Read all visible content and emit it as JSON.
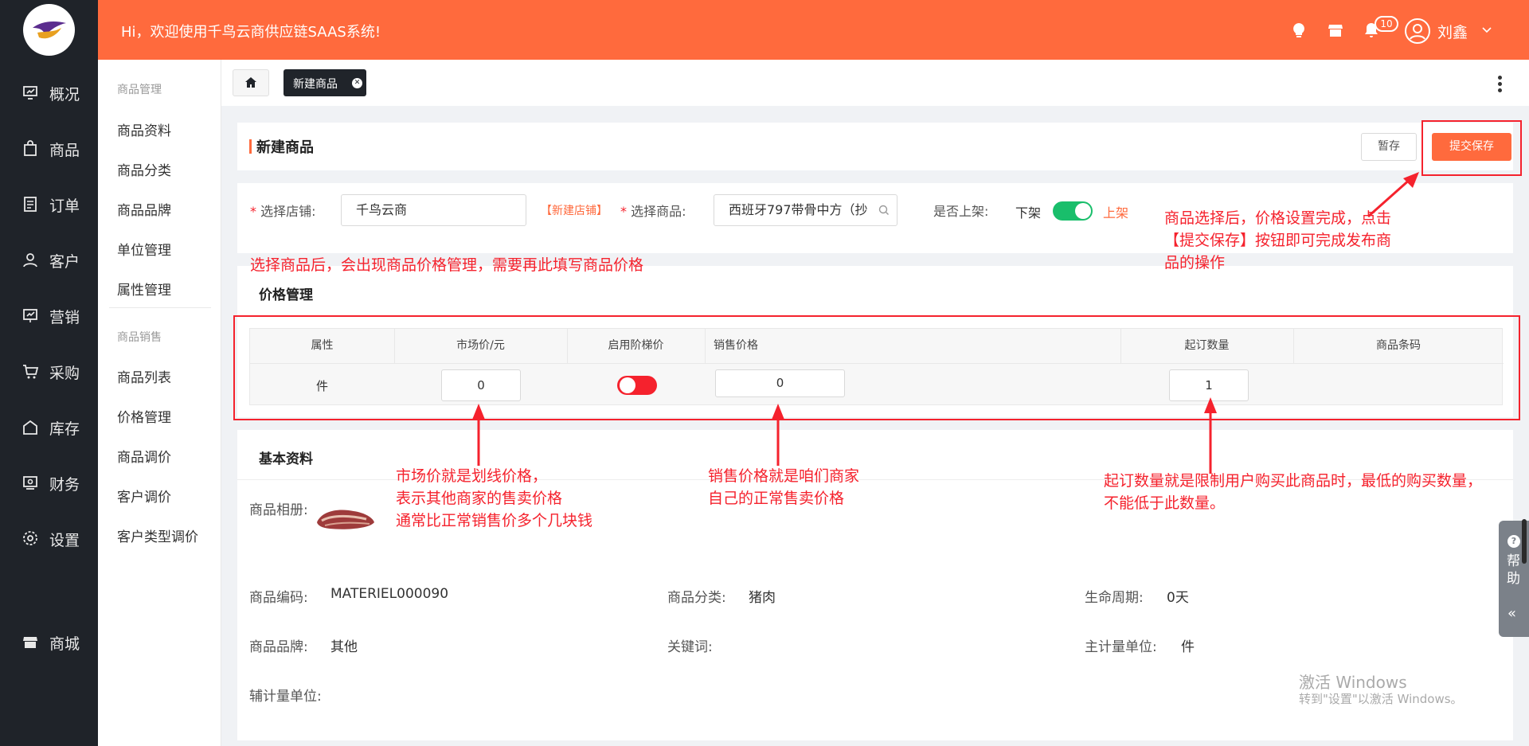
{
  "topbar": {
    "welcome": "Hi，欢迎使用千鸟云商供应链SAAS系统!",
    "notification_count": "10",
    "username": "刘鑫",
    "brand_color": "#ff6a3d"
  },
  "nav": {
    "items": [
      {
        "label": "概况",
        "icon": "dashboard-icon"
      },
      {
        "label": "商品",
        "icon": "shopping-bag-icon"
      },
      {
        "label": "订单",
        "icon": "order-icon"
      },
      {
        "label": "客户",
        "icon": "user-icon"
      },
      {
        "label": "营销",
        "icon": "marketing-icon"
      },
      {
        "label": "采购",
        "icon": "cart-icon"
      },
      {
        "label": "库存",
        "icon": "warehouse-icon"
      },
      {
        "label": "财务",
        "icon": "finance-icon"
      },
      {
        "label": "设置",
        "icon": "gear-icon"
      },
      {
        "label": "商城",
        "icon": "store-icon"
      }
    ]
  },
  "submenu": {
    "group1_title": "商品管理",
    "group1_items": [
      "商品资料",
      "商品分类",
      "商品品牌",
      "单位管理",
      "属性管理"
    ],
    "group2_title": "商品销售",
    "group2_items": [
      "商品列表",
      "价格管理",
      "商品调价",
      "客户调价",
      "客户类型调价"
    ]
  },
  "tabs": {
    "active_tab": "新建商品"
  },
  "form": {
    "page_title": "新建商品",
    "draft_button": "暂存",
    "submit_button": "提交保存",
    "store_label": "选择店铺:",
    "store_value": "千鸟云商",
    "new_store_link": "【新建店铺】",
    "product_label": "选择商品:",
    "product_value": "西班牙797带骨中方（抄",
    "shelf_label": "是否上架:",
    "shelf_off": "下架",
    "shelf_on": "上架",
    "shelf_enabled": true
  },
  "price": {
    "section_title": "价格管理",
    "columns": [
      "属性",
      "市场价/元",
      "启用阶梯价",
      "销售价格",
      "起订数量",
      "商品条码"
    ],
    "row": {
      "attribute": "件",
      "market_price": "0",
      "tiered_enabled": false,
      "sale_price": "0",
      "min_qty": "1",
      "barcode": ""
    }
  },
  "basic": {
    "section_title": "基本资料",
    "album_label": "商品相册:",
    "code_label": "商品编码:",
    "code_value": "MATERIEL000090",
    "category_label": "商品分类:",
    "category_value": "猪肉",
    "lifecycle_label": "生命周期:",
    "lifecycle_value": "0天",
    "brand_label": "商品品牌:",
    "brand_value": "其他",
    "keyword_label": "关键词:",
    "main_unit_label": "主计量单位:",
    "main_unit_value": "件",
    "aux_unit_label": "辅计量单位:"
  },
  "annotations": {
    "submit_note": [
      "商品选择后，价格设置完成，点击",
      "【提交保存】按钮即可完成发布商",
      "品的操作"
    ],
    "price_note": "选择商品后，会出现商品价格管理，需要再此填写商品价格",
    "market_note": [
      "市场价就是划线价格，",
      "表示其他商家的售卖价格",
      "通常比正常销售价多个几块钱"
    ],
    "sale_note": [
      "销售价格就是咱们商家",
      "自己的正常售卖价格"
    ],
    "qty_note": [
      "起订数量就是限制用户购买此商品时，最低的购买数量，",
      "不能低于此数量。"
    ]
  },
  "help": {
    "label": "帮助"
  },
  "watermark": {
    "line1": "激活 Windows",
    "line2": "转到\"设置\"以激活 Windows。"
  }
}
